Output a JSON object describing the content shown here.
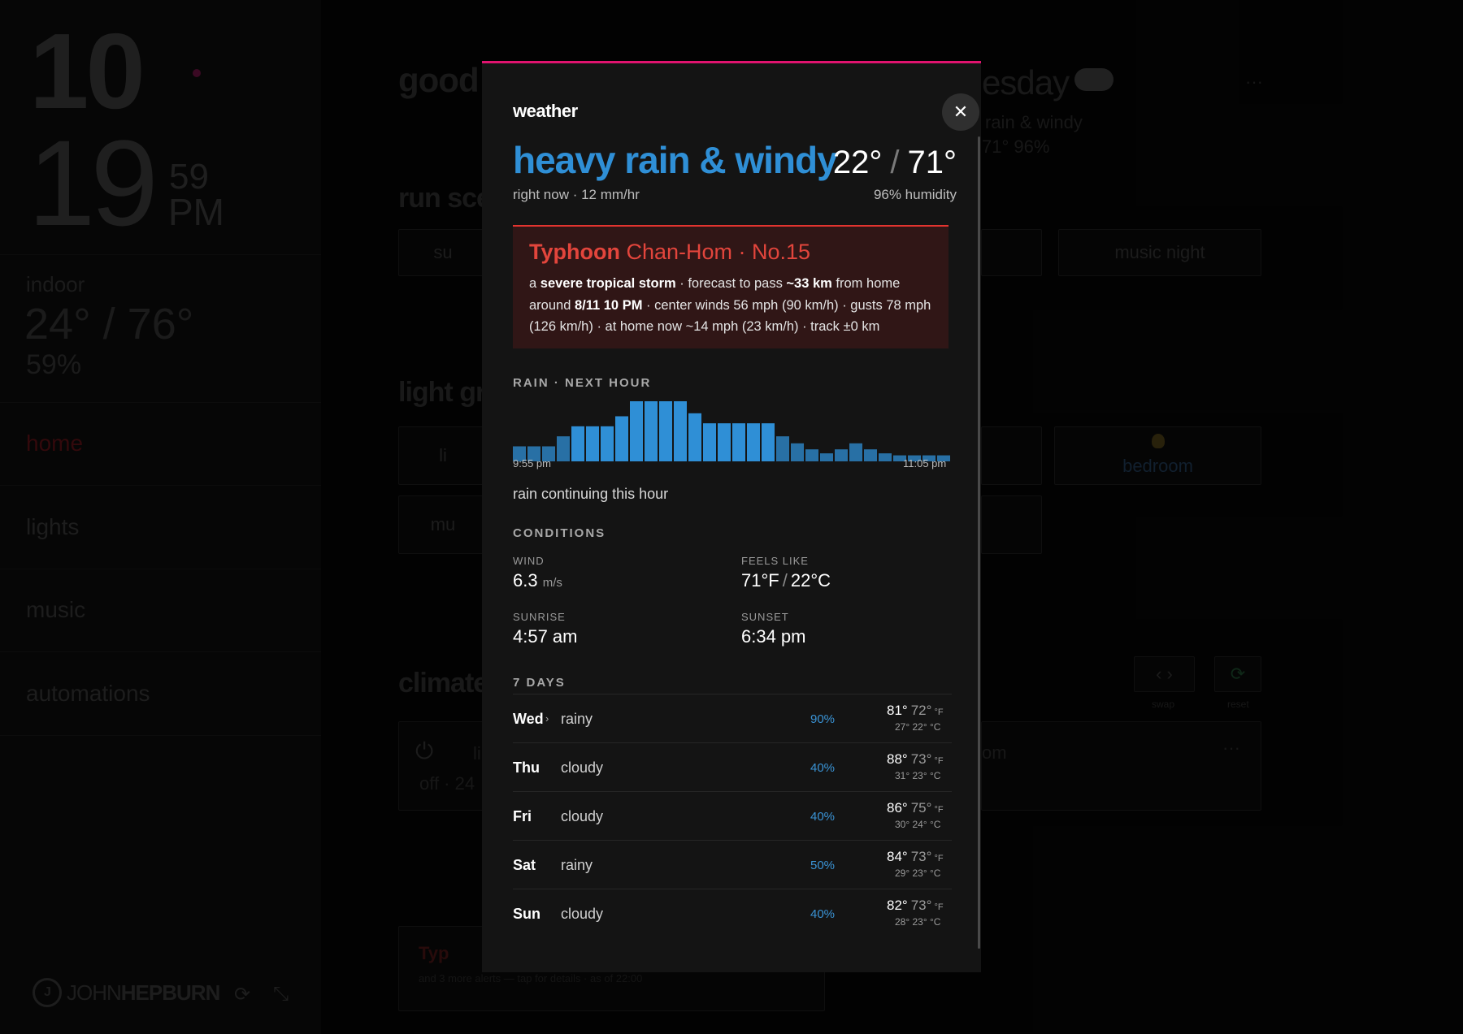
{
  "background": {
    "clock": {
      "hours": "10",
      "minutes": "19",
      "seconds": "59",
      "ampm": "PM"
    },
    "indoor": {
      "label": "indoor",
      "temp": "24° / 76°",
      "humidity": "59%"
    },
    "nav": [
      "home",
      "lights",
      "music",
      "automations"
    ],
    "brand": {
      "prefix": "JOHN",
      "suffix": "HEPBURN"
    },
    "greeting_start": "good",
    "greeting_end": "esday",
    "weather_summary": "rain & windy",
    "weather_summary_2": "71° 96%",
    "scenes_heading": "run sce",
    "scene_tile_1": "su",
    "scene_music_night": "music night",
    "lights_heading": "light gr",
    "light_tile_1": "li",
    "light_tile_2": "mu",
    "light_bedroom": "bedroom",
    "climate_heading": "climate",
    "climate_off": "off · 24",
    "climate_l": "li",
    "climate_om": "om",
    "climate_swap": "swap",
    "climate_reset": "reset",
    "alert_title": "Typ",
    "alert_sub": "and 3 more alerts — tap for details · as of 22:00"
  },
  "modal": {
    "title": "weather",
    "condition": "heavy rain & windy",
    "temp_c": "22°",
    "temp_f": "71°",
    "now_detail": "right now · 12 mm/hr",
    "humidity": "96% humidity",
    "alert": {
      "kind": "Typhoon",
      "name": "Chan-Hom · No.15",
      "p1": "a ",
      "b1": "severe tropical storm",
      "p2": " · forecast to pass ",
      "b2": "~33 km",
      "p3": " from home around ",
      "b3": "8/11 10 PM",
      "p4": " · center winds 56 mph (90 km/h) · gusts 78 mph (126 km/h) · at home now ~14 mph (23 km/h) · track ±0 km"
    },
    "rain_label": "RAIN · NEXT HOUR",
    "rain_start": "9:55 pm",
    "rain_end": "11:05 pm",
    "rain_note": "rain continuing this hour",
    "conditions_label": "CONDITIONS",
    "wind_label": "WIND",
    "wind_value": "6.3",
    "wind_unit": "m/s",
    "feels_label": "FEELS LIKE",
    "feels_f": "71°F",
    "feels_c": "22°C",
    "sunrise_label": "SUNRISE",
    "sunrise_value": "4:57 am",
    "sunset_label": "SUNSET",
    "sunset_value": "6:34 pm",
    "days_label": "7 DAYS",
    "days": [
      {
        "day": "Wed",
        "cond": "rainy",
        "pct": "90%",
        "hi": "81°",
        "lo": "72°",
        "unit": "°F",
        "c": "27° 22° °C"
      },
      {
        "day": "Thu",
        "cond": "cloudy",
        "pct": "40%",
        "hi": "88°",
        "lo": "73°",
        "unit": "°F",
        "c": "31° 23° °C"
      },
      {
        "day": "Fri",
        "cond": "cloudy",
        "pct": "40%",
        "hi": "86°",
        "lo": "75°",
        "unit": "°F",
        "c": "30° 24° °C"
      },
      {
        "day": "Sat",
        "cond": "rainy",
        "pct": "50%",
        "hi": "84°",
        "lo": "73°",
        "unit": "°F",
        "c": "29° 23° °C"
      },
      {
        "day": "Sun",
        "cond": "cloudy",
        "pct": "40%",
        "hi": "82°",
        "lo": "73°",
        "unit": "°F",
        "c": "28° 23° °C"
      }
    ]
  },
  "colors": {
    "accent": "#e0136f",
    "rain_bar": "#2f8fd6",
    "alert": "#e2453c"
  },
  "chart_data": {
    "type": "bar",
    "title": "RAIN · NEXT HOUR",
    "x_start": "9:55 pm",
    "x_end": "11:05 pm",
    "values": [
      15,
      15,
      15,
      25,
      35,
      35,
      35,
      45,
      60,
      60,
      60,
      60,
      48,
      38,
      38,
      38,
      38,
      38,
      25,
      18,
      12,
      8,
      12,
      18,
      12,
      8,
      6,
      6,
      6,
      6
    ],
    "ylim": [
      0,
      60
    ]
  }
}
